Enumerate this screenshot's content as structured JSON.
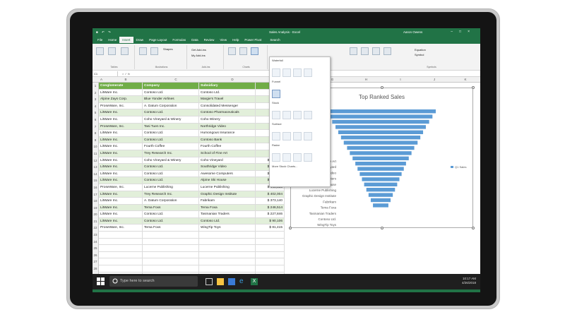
{
  "window": {
    "title": "Sales Analysis - Excel",
    "user": "Aaron Owens"
  },
  "ribbon_tabs": [
    "File",
    "Home",
    "Insert",
    "Draw",
    "Page Layout",
    "Formulas",
    "Data",
    "Review",
    "View",
    "Help",
    "Power Pivot"
  ],
  "active_tab": "Insert",
  "search_label": "Search",
  "namebox": "C1",
  "ribbon": {
    "tables_labels": [
      "PivotTable",
      "Recommended PivotTables",
      "Table"
    ],
    "shapes_label": "Shapes",
    "get_addins": "Get Add-ins",
    "my_addins": "My Add-ins",
    "recommended_charts": "Recommended Charts",
    "groups": [
      "Tables",
      "Illustrations",
      "Add-ins",
      "Charts"
    ],
    "equation": "Equation",
    "symbol": "Symbol",
    "symbols_group": "Symbols"
  },
  "columns": [
    "A",
    "B",
    "C",
    "D",
    "E",
    "F",
    "G",
    "H",
    "I",
    "J",
    "K"
  ],
  "table": {
    "headers": [
      "Conglomerate",
      "Company",
      "Subsidiary",
      "Q1 Sa"
    ],
    "rows": [
      [
        "LitWare Inc.",
        "Contoso Ltd.",
        "Contoso Ltd.",
        "$"
      ],
      [
        "Alpine Zays Corp.",
        "Blue Yonder Airlines",
        "Margie's Travel",
        "$"
      ],
      [
        "ProseWare, Inc.",
        "A. Datum Corporation",
        "Consolidated Messenger",
        "$"
      ],
      [
        "LitWare Inc.",
        "Contoso Ltd.",
        "Contoso Pharmaceuticals",
        "$"
      ],
      [
        "LitWare Inc.",
        "Coho Vineyard & Winery",
        "Coho Winery",
        "$"
      ],
      [
        "ProseWare, Inc.",
        "Tasi Tuen Inc.",
        "Northridge Video",
        "$"
      ],
      [
        "LitWare Inc.",
        "Contoso Ltd.",
        "Humongous Insurance",
        "$"
      ],
      [
        "LitWare Inc.",
        "Contoso Ltd.",
        "Contoso Bank",
        "$"
      ],
      [
        "LitWare Inc.",
        "Fourth Coffee",
        "Fourth Coffee",
        "$"
      ],
      [
        "LitWare Inc.",
        "Trey Research Inc.",
        "School of Fine Art",
        "$"
      ],
      [
        "LitWare Inc.",
        "Coho Vineyard & Winery",
        "Coho Vineyard",
        "$ 474,100"
      ],
      [
        "LitWare Inc.",
        "Contoso Ltd.",
        "Southridge Video",
        "$ 470,229"
      ],
      [
        "LitWare Inc.",
        "Contoso Ltd.",
        "Awesome Computers",
        "$ 448,399"
      ],
      [
        "LitWare Inc.",
        "Contoso Ltd.",
        "Alpine Ski House",
        "$ 440,728"
      ],
      [
        "ProseWare, Inc.",
        "Lucerne Publishing",
        "Lucerne Publishing",
        "$ 446,553"
      ],
      [
        "LitWare Inc.",
        "Trey Research Inc.",
        "Graphic Design Institute",
        "$ 402,004"
      ],
      [
        "LitWare Inc.",
        "A. Datum Corporation",
        "Fabrikam",
        "$ 373,140"
      ],
      [
        "LitWare Inc.",
        "Tema Foxs",
        "Tema Foxa",
        "$ 246,514"
      ],
      [
        "LitWare Inc.",
        "Contoso Ltd.",
        "Tasmanian Traders",
        "$ 227,846"
      ],
      [
        "LitWare Inc.",
        "Contoso Ltd.",
        "Contoso Ltd.",
        "$ 90,106"
      ],
      [
        "ProseWare, Inc.",
        "Tema Foxs",
        "WingTip Toys",
        "$ 81,415"
      ]
    ]
  },
  "row_numbers": [
    "1",
    "2",
    "3",
    "4",
    "5",
    "6",
    "7",
    "8",
    "9",
    "10",
    "11",
    "12",
    "13",
    "14",
    "15",
    "16",
    "17",
    "18",
    "19",
    "20",
    "21",
    "22",
    "23",
    "24",
    "25",
    "26",
    "27",
    "28",
    "29",
    "30"
  ],
  "gallery": {
    "sections": [
      "Waterfall",
      "Funnel",
      "Stock",
      "Surface",
      "Radar"
    ],
    "more": "More Stock Charts..."
  },
  "chart_data": {
    "type": "bar",
    "orientation": "horizontal-funnel",
    "title": "Top Ranked Sales",
    "legend": "Q1 Sales",
    "legend_position": "right",
    "categories": [
      "School of Fine Art",
      "Coho Vineyard",
      "Southridge Video",
      "Awesome Computers",
      "Alpine Ski House",
      "Lucerne Publishing",
      "Graphic Design Institute",
      "Fabrikam",
      "Tema Foxa",
      "Tasmanian Traders",
      "Contoso Ltd.",
      "WingTip Toys"
    ],
    "values": [
      100,
      94,
      88,
      82,
      77,
      72,
      67,
      61,
      56,
      51,
      46,
      42,
      38,
      34,
      30,
      26,
      22,
      18,
      14
    ],
    "color": "#5b9bd5"
  },
  "sheet_tab": "Sales Analysis",
  "taskbar": {
    "search_text": "Type here to search",
    "time": "10:17 AM",
    "date": "4/26/2018"
  }
}
